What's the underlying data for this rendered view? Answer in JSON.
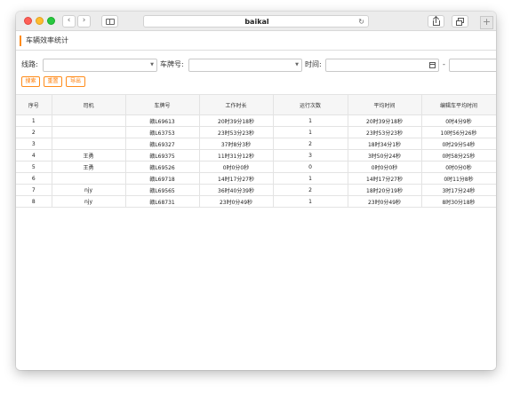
{
  "browser": {
    "url": "baikal"
  },
  "page": {
    "title": "车辆效率统计"
  },
  "filters": {
    "route_label": "线路:",
    "plate_label": "车牌号:",
    "time_label": "时间:",
    "range_sep": "-"
  },
  "actions": {
    "search": "搜索",
    "reset": "重置",
    "export": "导出"
  },
  "table": {
    "columns": [
      "序号",
      "司机",
      "车牌号",
      "工作时长",
      "运行次数",
      "平均时间",
      "编辑车平均时间"
    ],
    "rows": [
      [
        "1",
        "",
        "赣L69613",
        "20时39分18秒",
        "1",
        "20时39分18秒",
        "0时4分9秒"
      ],
      [
        "2",
        "",
        "赣L63753",
        "23时53分23秒",
        "1",
        "23时53分23秒",
        "10时56分26秒"
      ],
      [
        "3",
        "",
        "赣L69327",
        "37时8分3秒",
        "2",
        "18时34分1秒",
        "0时29分54秒"
      ],
      [
        "4",
        "王勇",
        "赣L69375",
        "11时31分12秒",
        "3",
        "3时50分24秒",
        "0时58分25秒"
      ],
      [
        "5",
        "王勇",
        "赣L69526",
        "0时0分0秒",
        "0",
        "0时0分0秒",
        "0时0分0秒"
      ],
      [
        "6",
        "",
        "赣L69718",
        "14时17分27秒",
        "1",
        "14时17分27秒",
        "0时11分8秒"
      ],
      [
        "7",
        "njy",
        "赣L69565",
        "36时40分39秒",
        "2",
        "18时20分19秒",
        "3时17分24秒"
      ],
      [
        "8",
        "njy",
        "赣L68731",
        "23时0分49秒",
        "1",
        "23时0分49秒",
        "8时30分18秒"
      ]
    ]
  }
}
